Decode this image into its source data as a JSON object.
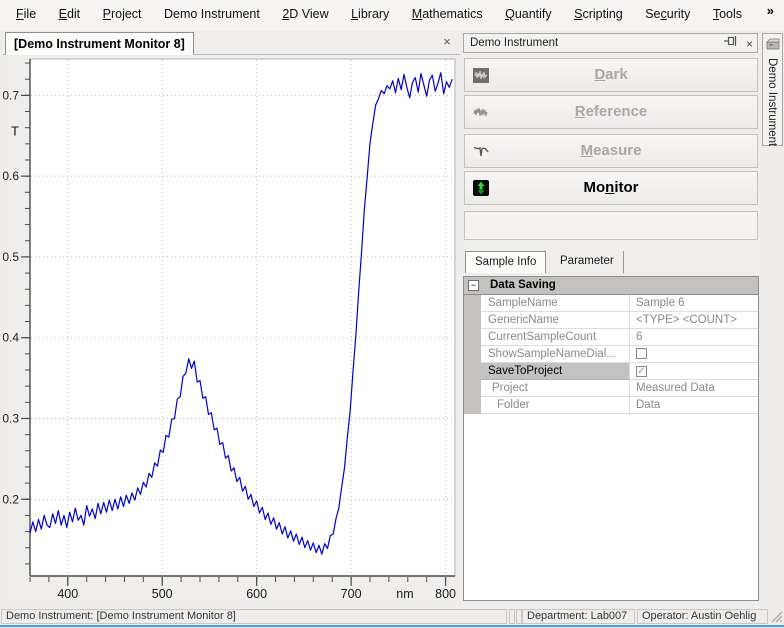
{
  "menu": {
    "overflow_chevron": "»",
    "items": [
      {
        "label": "File",
        "mnemonic": 0
      },
      {
        "label": "Edit",
        "mnemonic": 0
      },
      {
        "label": "Project",
        "mnemonic": 0
      },
      {
        "label": "Demo Instrument"
      },
      {
        "label": "2D View",
        "mnemonic": 0
      },
      {
        "label": "Library",
        "mnemonic": 0
      },
      {
        "label": "Mathematics",
        "mnemonic": 0
      },
      {
        "label": "Quantify",
        "mnemonic": 0
      },
      {
        "label": "Scripting",
        "mnemonic": 0
      },
      {
        "label": "Security",
        "mnemonic": 2
      },
      {
        "label": "Tools",
        "mnemonic": 0
      }
    ]
  },
  "chart_window": {
    "tab_title": "[Demo Instrument Monitor 8]",
    "close_glyph": "×"
  },
  "chart_data": {
    "type": "line",
    "title": "",
    "xlabel": "nm",
    "ylabel": "T",
    "xlim": [
      360,
      810
    ],
    "ylim": [
      0.105,
      0.745
    ],
    "x_ticks_major": [
      400,
      500,
      600,
      700,
      800
    ],
    "y_ticks_major": [
      0.2,
      0.3,
      0.4,
      0.5,
      0.6,
      0.7
    ],
    "x_minor_step": 20,
    "y_minor_step": 0.02,
    "grid": "dotted",
    "legend": "none",
    "line_color": "#0000cd",
    "x_start": 360,
    "x_step": 3,
    "values": [
      0.158,
      0.172,
      0.16,
      0.175,
      0.163,
      0.18,
      0.168,
      0.165,
      0.182,
      0.17,
      0.186,
      0.168,
      0.18,
      0.165,
      0.184,
      0.172,
      0.189,
      0.174,
      0.18,
      0.168,
      0.192,
      0.179,
      0.188,
      0.176,
      0.195,
      0.182,
      0.196,
      0.184,
      0.199,
      0.186,
      0.2,
      0.188,
      0.203,
      0.191,
      0.205,
      0.195,
      0.208,
      0.199,
      0.214,
      0.206,
      0.221,
      0.215,
      0.232,
      0.227,
      0.245,
      0.241,
      0.261,
      0.258,
      0.279,
      0.277,
      0.299,
      0.3,
      0.324,
      0.327,
      0.352,
      0.356,
      0.374,
      0.362,
      0.371,
      0.345,
      0.347,
      0.325,
      0.327,
      0.305,
      0.307,
      0.286,
      0.288,
      0.268,
      0.27,
      0.251,
      0.254,
      0.235,
      0.239,
      0.222,
      0.227,
      0.21,
      0.216,
      0.2,
      0.206,
      0.191,
      0.198,
      0.183,
      0.19,
      0.175,
      0.183,
      0.169,
      0.177,
      0.163,
      0.171,
      0.157,
      0.166,
      0.152,
      0.161,
      0.148,
      0.157,
      0.144,
      0.153,
      0.14,
      0.149,
      0.137,
      0.146,
      0.134,
      0.143,
      0.132,
      0.145,
      0.139,
      0.155,
      0.157,
      0.176,
      0.189,
      0.215,
      0.239,
      0.276,
      0.31,
      0.358,
      0.402,
      0.457,
      0.505,
      0.558,
      0.599,
      0.641,
      0.665,
      0.688,
      0.696,
      0.706,
      0.702,
      0.712,
      0.708,
      0.718,
      0.703,
      0.721,
      0.707,
      0.726,
      0.71,
      0.697,
      0.716,
      0.722,
      0.704,
      0.727,
      0.713,
      0.699,
      0.719,
      0.725,
      0.705,
      0.715,
      0.728,
      0.702,
      0.717,
      0.71,
      0.72
    ]
  },
  "instrument_panel": {
    "title": "Demo Instrument",
    "close_glyph": "×",
    "buttons": [
      {
        "label": "Dark",
        "mnemonic": 0,
        "enabled": false
      },
      {
        "label": "Reference",
        "mnemonic": 0,
        "enabled": false
      },
      {
        "label": "Measure",
        "mnemonic": 0,
        "enabled": false
      },
      {
        "label": "Monitor",
        "mnemonic": 2,
        "enabled": true
      }
    ],
    "tabs": [
      {
        "label": "Sample Info",
        "active": true
      },
      {
        "label": "Parameter",
        "active": false
      }
    ],
    "property_grid": {
      "section_label": "Data Saving",
      "collapse_glyph": "−",
      "rows": [
        {
          "label": "SampleName",
          "value": "Sample 6"
        },
        {
          "label": "GenericName",
          "value": "<TYPE> <COUNT>"
        },
        {
          "label": "CurrentSampleCount",
          "value": "6"
        },
        {
          "label": "ShowSampleNameDial...",
          "value": "",
          "checkbox": "unchecked",
          "check_glyph": ""
        },
        {
          "label": "SaveToProject",
          "value": "",
          "checkbox": "checked",
          "check_glyph": "✓",
          "selected": true
        },
        {
          "label": "Project",
          "value": "Measured Data",
          "indent": 1
        },
        {
          "label": "Folder",
          "value": "Data",
          "indent": 2
        }
      ]
    }
  },
  "side_tab": {
    "label": "Demo Instrument"
  },
  "status_bar": {
    "left": "Demo Instrument: [Demo Instrument Monitor 8]",
    "department": "Department: Lab007",
    "operator": "Operator: Austin Oehlig"
  }
}
